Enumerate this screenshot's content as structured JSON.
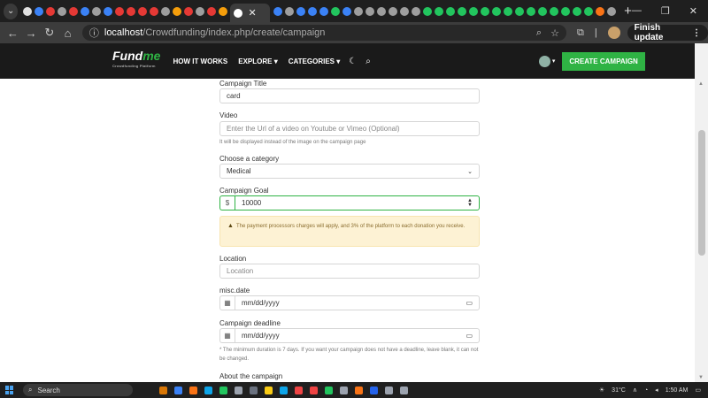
{
  "browser": {
    "tab_title": "",
    "new_tab": "+",
    "url_host": "localhost",
    "url_path": "/Crowdfunding/index.php/create/campaign",
    "finish_update": "Finish update",
    "tab_colors": [
      "#e0e0e0",
      "#3b82f6",
      "#e53935",
      "#9e9e9e",
      "#e53935",
      "#3b82f6",
      "#9e9e9e",
      "#3b82f6",
      "#e53935",
      "#e53935",
      "#e53935",
      "#e53935",
      "#9e9e9e",
      "#f59e0b",
      "#e53935",
      "#9e9e9e",
      "#e53935",
      "#f59e0b"
    ],
    "tab_colors_right": [
      "#3b82f6",
      "#9e9e9e",
      "#3b82f6",
      "#3b82f6",
      "#3b82f6",
      "#22c55e",
      "#3b82f6",
      "#9e9e9e",
      "#9e9e9e",
      "#9e9e9e",
      "#9e9e9e",
      "#9e9e9e",
      "#9e9e9e",
      "#22c55e",
      "#22c55e",
      "#22c55e",
      "#22c55e",
      "#22c55e",
      "#22c55e",
      "#22c55e",
      "#22c55e",
      "#22c55e",
      "#22c55e",
      "#22c55e",
      "#22c55e",
      "#22c55e",
      "#22c55e",
      "#22c55e",
      "#f97316",
      "#9e9e9e"
    ]
  },
  "site": {
    "logo_main": "Fund",
    "logo_accent": "me",
    "logo_sub": "Crowdfunding Platform",
    "nav": [
      "HOW IT WORKS",
      "EXPLORE ▾",
      "CATEGORIES ▾"
    ],
    "create_button": "CREATE CAMPAIGN",
    "accent_color": "#2fb344"
  },
  "form": {
    "title_label": "Campaign Title",
    "title_value": "card",
    "video_label": "Video",
    "video_placeholder": "Enter the Url of a video on Youtube or Vimeo (Optional)",
    "video_hint": "It will be displayed instead of the image on the campaign page",
    "category_label": "Choose a category",
    "category_value": "Medical",
    "goal_label": "Campaign Goal",
    "goal_currency": "$",
    "goal_value": "10000",
    "warning_text": "The payment processors charges will apply, and 3% of the platform to each donation you receive.",
    "location_label": "Location",
    "location_placeholder": "Location",
    "misc_label": "misc.date",
    "date_placeholder": "mm/dd/yyyy",
    "deadline_label": "Campaign deadline",
    "deadline_placeholder": "mm/dd/yyyy",
    "deadline_hint": "* The minimum duration is 7 days. If you want your campaign does not have a deadline, leave blank, it can not be changed.",
    "about_label": "About the campaign"
  },
  "taskbar": {
    "search": "Search",
    "temperature": "31°C",
    "time": "1:50 AM",
    "app_colors": [
      "#d97706",
      "#3b82f6",
      "#f97316",
      "#0ea5e9",
      "#22c55e",
      "#9ca3af",
      "#6b7280",
      "#facc15",
      "#0ea5e9",
      "#ef4444",
      "#ef4444",
      "#22c55e",
      "#9ca3af",
      "#f97316",
      "#2563eb",
      "#9ca3af",
      "#9ca3af"
    ]
  }
}
